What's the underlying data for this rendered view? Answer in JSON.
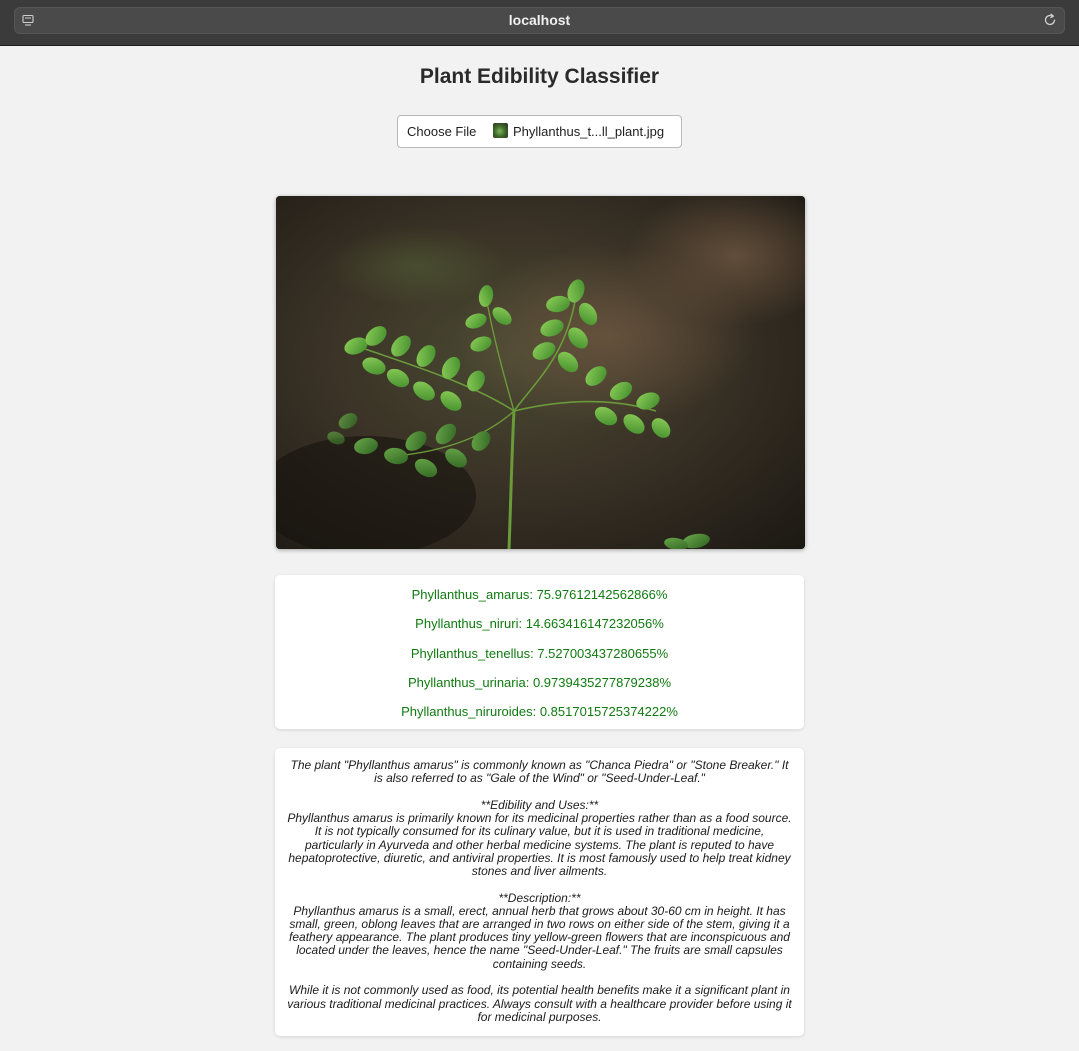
{
  "browser": {
    "url": "localhost"
  },
  "page": {
    "title": "Plant Edibility Classifier"
  },
  "upload": {
    "button_label": "Choose File",
    "file_name": "Phyllanthus_t...ll_plant.jpg"
  },
  "predictions": [
    "Phyllanthus_amarus: 75.97612142562866%",
    "Phyllanthus_niruri: 14.663416147232056%",
    "Phyllanthus_tenellus: 7.527003437280655%",
    "Phyllanthus_urinaria: 0.9739435277879238%",
    "Phyllanthus_niruroides: 0.8517015725374222%"
  ],
  "description": {
    "intro": "The plant \"Phyllanthus amarus\" is commonly known as \"Chanca Piedra\" or \"Stone Breaker.\" It is also referred to as \"Gale of the Wind\" or \"Seed-Under-Leaf.\"",
    "edibility_heading": "**Edibility and Uses:**",
    "edibility_text": "Phyllanthus amarus is primarily known for its medicinal properties rather than as a food source. It is not typically consumed for its culinary value, but it is used in traditional medicine, particularly in Ayurveda and other herbal medicine systems. The plant is reputed to have hepatoprotective, diuretic, and antiviral properties. It is most famously used to help treat kidney stones and liver ailments.",
    "description_heading": "**Description:**",
    "description_text": "Phyllanthus amarus is a small, erect, annual herb that grows about 30-60 cm in height. It has small, green, oblong leaves that are arranged in two rows on either side of the stem, giving it a feathery appearance. The plant produces tiny yellow-green flowers that are inconspicuous and located under the leaves, hence the name \"Seed-Under-Leaf.\" The fruits are small capsules containing seeds.",
    "closing": "While it is not commonly used as food, its potential health benefits make it a significant plant in various traditional medicinal practices. Always consult with a healthcare provider before using it for medicinal purposes."
  },
  "colors": {
    "prediction_text": "#0f7a0f",
    "page_background": "#f2f2f2",
    "chrome_background": "#3b3b3b"
  },
  "icons": {
    "sidebar": "sidebar-icon",
    "reload": "reload-icon",
    "file_thumbnail": "image-thumbnail-icon"
  }
}
